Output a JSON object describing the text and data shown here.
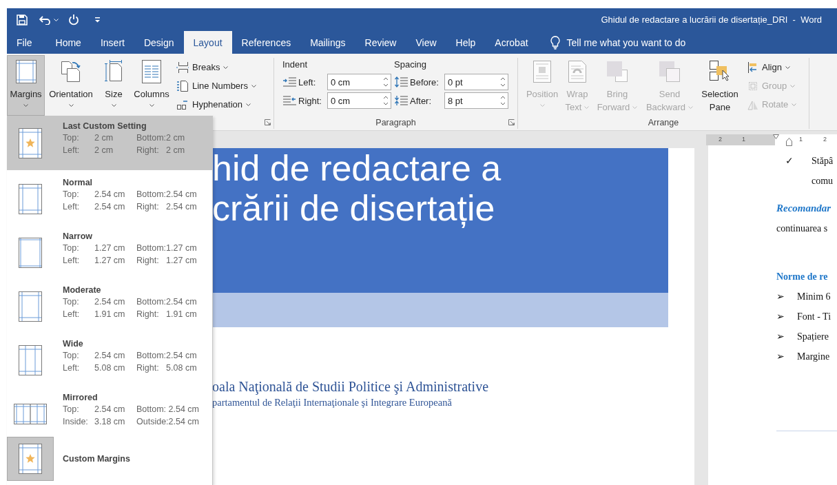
{
  "title_bar": {
    "title": "Ghidul de redactare a lucrării de disertație_DRI  -  Word"
  },
  "tabs": [
    {
      "label": "File",
      "selected": false
    },
    {
      "label": "Home",
      "selected": false
    },
    {
      "label": "Insert",
      "selected": false
    },
    {
      "label": "Design",
      "selected": false
    },
    {
      "label": "Layout",
      "selected": true
    },
    {
      "label": "References",
      "selected": false
    },
    {
      "label": "Mailings",
      "selected": false
    },
    {
      "label": "Review",
      "selected": false
    },
    {
      "label": "View",
      "selected": false
    },
    {
      "label": "Help",
      "selected": false
    },
    {
      "label": "Acrobat",
      "selected": false
    }
  ],
  "tell_me": {
    "placeholder": "Tell me what you want to do"
  },
  "ribbon": {
    "page_setup": {
      "large_buttons": [
        {
          "kind": "margins",
          "lines": [
            "Margins"
          ],
          "selected": true,
          "dropdown": true
        },
        {
          "kind": "orientation",
          "lines": [
            "Orientation"
          ],
          "selected": false,
          "dropdown": true
        },
        {
          "kind": "size",
          "lines": [
            "Size"
          ],
          "selected": false,
          "dropdown": true
        },
        {
          "kind": "columns",
          "lines": [
            "Columns"
          ],
          "selected": false,
          "dropdown": true
        }
      ],
      "small_buttons": [
        {
          "kind": "breaks",
          "label": "Breaks",
          "disabled": false
        },
        {
          "kind": "line_numbers",
          "label": "Line Numbers",
          "disabled": false
        },
        {
          "kind": "hyphenation",
          "label": "Hyphenation",
          "disabled": false
        }
      ]
    },
    "paragraph": {
      "label": "Paragraph",
      "columns": [
        {
          "heading": "Indent",
          "fields": [
            {
              "kind": "indent_left",
              "label": "Left:",
              "value": "0 cm"
            },
            {
              "kind": "indent_right",
              "label": "Right:",
              "value": "0 cm"
            }
          ]
        },
        {
          "heading": "Spacing",
          "fields": [
            {
              "kind": "space_before",
              "label": "Before:",
              "value": "0 pt"
            },
            {
              "kind": "space_after",
              "label": "After:",
              "value": "8 pt"
            }
          ]
        }
      ]
    },
    "arrange": {
      "label": "Arrange",
      "large_buttons": [
        {
          "kind": "position",
          "lines": [
            "Position"
          ],
          "disabled": true,
          "dropdown": true
        },
        {
          "kind": "wrap_text",
          "lines": [
            "Wrap",
            "Text"
          ],
          "disabled": true,
          "dropdown": true
        },
        {
          "kind": "bring_forward",
          "lines": [
            "Bring",
            "Forward"
          ],
          "disabled": true,
          "dropdown": true
        },
        {
          "kind": "send_backward",
          "lines": [
            "Send",
            "Backward"
          ],
          "disabled": true,
          "dropdown": true
        },
        {
          "kind": "selection_pane",
          "lines": [
            "Selection",
            "Pane"
          ],
          "disabled": false,
          "dropdown": false
        }
      ],
      "small_buttons": [
        {
          "kind": "align",
          "label": "Align",
          "disabled": false
        },
        {
          "kind": "group",
          "label": "Group",
          "disabled": true
        },
        {
          "kind": "rotate",
          "label": "Rotate",
          "disabled": true
        }
      ]
    }
  },
  "margins_menu": {
    "items": [
      {
        "kind": "last_custom",
        "name": "Last Custom Setting",
        "selected": true,
        "rows": [
          [
            "Top:",
            "2 cm",
            "Bottom:",
            "2 cm"
          ],
          [
            "Left:",
            "2 cm",
            "Right:",
            "2 cm"
          ]
        ]
      },
      {
        "kind": "normal",
        "name": "Normal",
        "selected": false,
        "rows": [
          [
            "Top:",
            "2.54 cm",
            "Bottom:",
            "2.54 cm"
          ],
          [
            "Left:",
            "2.54 cm",
            "Right:",
            "2.54 cm"
          ]
        ]
      },
      {
        "kind": "narrow",
        "name": "Narrow",
        "selected": false,
        "rows": [
          [
            "Top:",
            "1.27 cm",
            "Bottom:",
            "1.27 cm"
          ],
          [
            "Left:",
            "1.27 cm",
            "Right:",
            "1.27 cm"
          ]
        ]
      },
      {
        "kind": "moderate",
        "name": "Moderate",
        "selected": false,
        "rows": [
          [
            "Top:",
            "2.54 cm",
            "Bottom:",
            "2.54 cm"
          ],
          [
            "Left:",
            "1.91 cm",
            "Right:",
            "1.91 cm"
          ]
        ]
      },
      {
        "kind": "wide",
        "name": "Wide",
        "selected": false,
        "rows": [
          [
            "Top:",
            "2.54 cm",
            "Bottom:",
            "2.54 cm"
          ],
          [
            "Left:",
            "5.08 cm",
            "Right:",
            "5.08 cm"
          ]
        ]
      },
      {
        "kind": "mirrored",
        "name": "Mirrored",
        "selected": false,
        "rows": [
          [
            "Top:",
            "2.54 cm",
            "Bottom:",
            "2.54 cm"
          ],
          [
            "Inside:",
            "3.18 cm",
            "Outside:",
            "2.54 cm"
          ]
        ]
      },
      {
        "kind": "dialog",
        "name": "Custom Margins",
        "selected": false
      }
    ]
  },
  "document": {
    "left_page": {
      "title_lines": [
        "hid de redactare a",
        "crării de disertație"
      ],
      "institution_lines": [
        "oala Naţională de Studii Politice şi Administrative",
        "partamentul de Relaţii Internaţionale şi Integrare Europeană"
      ]
    },
    "right_page": {
      "ruler_labels": [
        "2",
        "1",
        "1",
        "2"
      ],
      "lines": [
        {
          "kind": "check",
          "marker": "✓",
          "text": "Stăpâ"
        },
        {
          "kind": "continuation",
          "text": "comu"
        },
        {
          "kind": "emphasis",
          "text": "Recomandar"
        },
        {
          "kind": "body",
          "text": "continuarea s"
        },
        {
          "kind": "heading",
          "text": "Norme de re"
        },
        {
          "kind": "bullet",
          "marker": "➢",
          "text": "Minim 6"
        },
        {
          "kind": "bullet",
          "marker": "➢",
          "text": "Font - Ti"
        },
        {
          "kind": "bullet",
          "marker": "➢",
          "text": "Spațiere"
        },
        {
          "kind": "bullet",
          "marker": "➢",
          "text": "Margine"
        }
      ]
    }
  }
}
